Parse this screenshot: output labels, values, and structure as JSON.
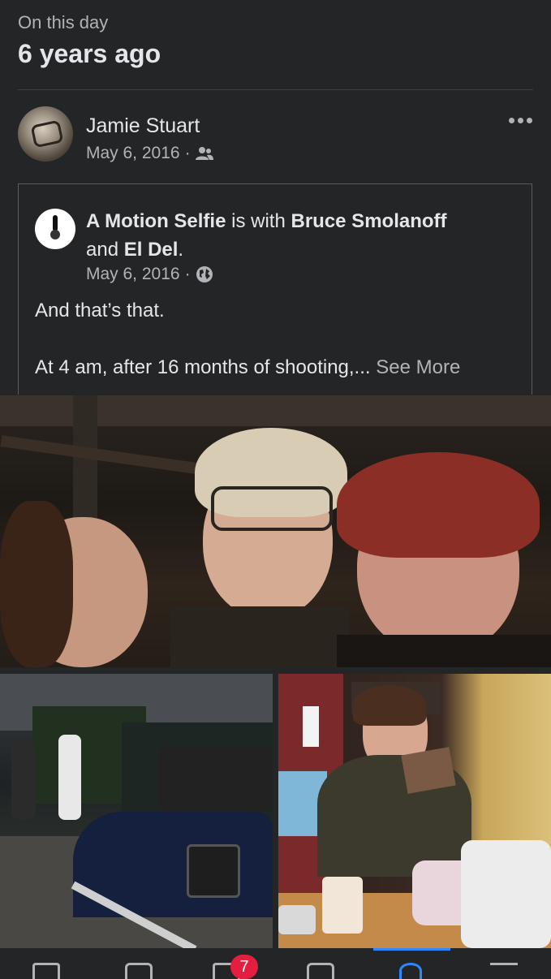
{
  "memory": {
    "eyebrow": "On this day",
    "years_ago": "6 years ago"
  },
  "post": {
    "author": "Jamie Stuart",
    "date": "May 6, 2016",
    "date_separator": "·",
    "audience_icon": "friends-icon",
    "more_icon": "more-horizontal-icon"
  },
  "shared_post": {
    "page_name": "A Motion Selfie",
    "is_with": "is with",
    "friend1": "Bruce Smolanoff",
    "and": "and",
    "friend2": "El Del",
    "period": ".",
    "date": "May 6, 2016",
    "date_separator": "·",
    "audience_icon": "globe-icon",
    "text_line1": "And that’s that.",
    "text_line2": "At 4 am, after 16 months of shooting,...",
    "see_more": "See More"
  },
  "photos": {
    "main": "selfie-photo",
    "left": "film-set-photo",
    "right": "makeup-photo"
  },
  "tabbar": {
    "icons": [
      "home-icon",
      "friends-icon",
      "video-icon",
      "marketplace-icon",
      "profile-icon",
      "menu-icon"
    ],
    "notification_count": "7",
    "active_color": "#2d88ff",
    "badge_color": "#e41e3f"
  }
}
